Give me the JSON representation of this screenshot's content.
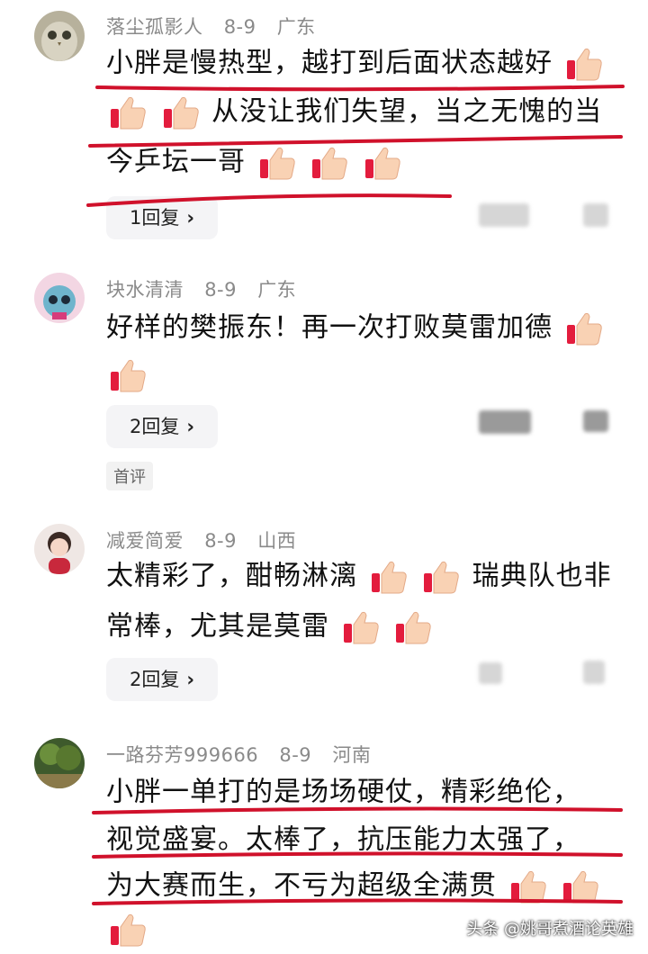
{
  "colors": {
    "underline": "#d0112b",
    "meta": "#8a8a8a",
    "reply_bg": "#f4f4f6"
  },
  "comments": [
    {
      "user": "落尘孤影人",
      "date": "8-9",
      "location": "广东",
      "avatar": "owl-avatar",
      "lines": [
        "小胖是慢热型，越打到后面状态越好",
        "从没让我们失望，当之无愧的当",
        "今乒坛一哥"
      ],
      "reply_label": "1回复"
    },
    {
      "user": "块水清清",
      "date": "8-9",
      "location": "广东",
      "avatar": "cartoon-avatar",
      "lines": [
        "好样的樊振东！再一次打败莫雷加德"
      ],
      "reply_label": "2回复",
      "badge": "首评"
    },
    {
      "user": "减爱简爱",
      "date": "8-9",
      "location": "山西",
      "avatar": "girl-avatar",
      "lines": [
        "太精彩了，酣畅淋漓",
        "瑞典队也非",
        "常棒，尤其是莫雷"
      ],
      "reply_label": "2回复"
    },
    {
      "user": "一路芬芳999666",
      "date": "8-9",
      "location": "河南",
      "avatar": "nature-avatar",
      "lines": [
        "小胖一单打的是场场硬仗，精彩绝伦，",
        "视觉盛宴。太棒了，抗压能力太强了，",
        "为大赛而生，不亏为超级全满贯"
      ]
    }
  ],
  "icons": {
    "emoji": "thumbs-up-icon",
    "chevron": "›"
  },
  "watermark": "头条 @姚哥煮酒论英雄"
}
